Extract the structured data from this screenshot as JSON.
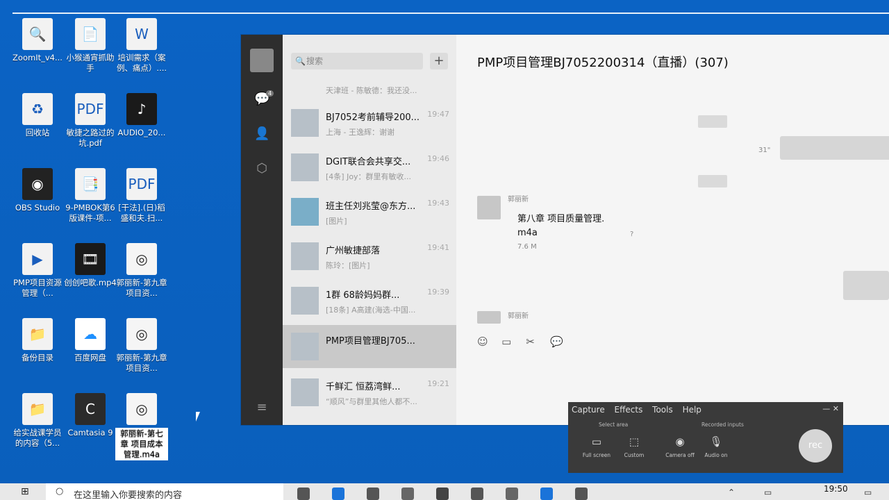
{
  "desktop": {
    "icons": [
      {
        "label": "ZoomIt_v4...",
        "icon": "zoomit-icon"
      },
      {
        "label": "小猴通宵抓助手",
        "icon": "shortcut-doc-icon"
      },
      {
        "label": "培训需求（案例、痛点）....",
        "icon": "word-doc-icon"
      },
      {
        "label": "回收站",
        "icon": "recycle-bin-icon"
      },
      {
        "label": "敏捷之路过的坑.pdf",
        "icon": "pdf-icon"
      },
      {
        "label": "AUDIO_20...",
        "icon": "audio-file-icon"
      },
      {
        "label": "OBS Studio",
        "icon": "obs-icon"
      },
      {
        "label": "9-PMBOK第6版课件-项...",
        "icon": "doc-icon"
      },
      {
        "label": "[干法].(日)稻盛和夫.扫...",
        "icon": "pdf-icon"
      },
      {
        "label": "PMP项目资源管理（...",
        "icon": "video-file-icon"
      },
      {
        "label": "创创吧歌.mp4",
        "icon": "video-file-icon"
      },
      {
        "label": "郭丽新-第九章 项目资...",
        "icon": "music-file-icon"
      },
      {
        "label": "备份目录",
        "icon": "folder-icon"
      },
      {
        "label": "百度网盘",
        "icon": "baidu-netdisk-icon"
      },
      {
        "label": "郭丽新-第九章 项目资...",
        "icon": "music-file-icon"
      },
      {
        "label": "给实战课学员的内容（5...",
        "icon": "folder-icon"
      },
      {
        "label": "Camtasia 9",
        "icon": "camtasia-icon"
      },
      {
        "label": "郭丽新-第七章 项目成本管理.m4a",
        "icon": "music-file-icon"
      }
    ]
  },
  "chat": {
    "search_placeholder": "搜索",
    "plus": "+",
    "badge": "4",
    "conversations": [
      {
        "name": "",
        "preview": "天津班 - 陈敏德：我还没...",
        "time": ""
      },
      {
        "name": "BJ7052考前辅导200...",
        "preview": "上海 - 王逸辉：谢谢",
        "time": "19:47"
      },
      {
        "name": "DGIT联合会共享交...",
        "preview": "[4条] Joy：群里有敏收...",
        "time": "19:46"
      },
      {
        "name": "班主任刘兆莹@东方...",
        "preview": "[图片]",
        "time": "19:43"
      },
      {
        "name": "广州敏捷部落",
        "preview": "陈玲：[图片]",
        "time": "19:41"
      },
      {
        "name": "1群 68龄妈妈群...",
        "preview": "[18条] A高建(海选-中国...",
        "time": "19:39"
      },
      {
        "name": "PMP项目管理BJ705...",
        "preview": "",
        "time": ""
      },
      {
        "name": "千鲜汇 恒荔湾鲜...",
        "preview": "“顺风”与群里其他人都不...",
        "time": "19:21"
      }
    ],
    "title": "PMP项目管理BJ7052200314（直播）(307)",
    "messages": {
      "duration_label": "31\"",
      "sender1": "郭丽新",
      "file_name": "第八章 项目质量管理.",
      "file_ext": "m4a",
      "file_size": "7.6 M",
      "file_icon": "?",
      "sender2": "郭丽新"
    },
    "tools": [
      "emoji-icon",
      "folder-icon",
      "scissors-icon",
      "chat-history-icon"
    ]
  },
  "recorder": {
    "menu": [
      "Capture",
      "Effects",
      "Tools",
      "Help"
    ],
    "select_area": "Select area",
    "recorded_inputs": "Recorded inputs",
    "full_screen": "Full screen",
    "custom": "Custom",
    "camera": "Camera off",
    "audio": "Audio on",
    "rec": "rec"
  },
  "taskbar": {
    "search_text": "在这里输入你要搜索的内容",
    "clock": "19:50"
  }
}
